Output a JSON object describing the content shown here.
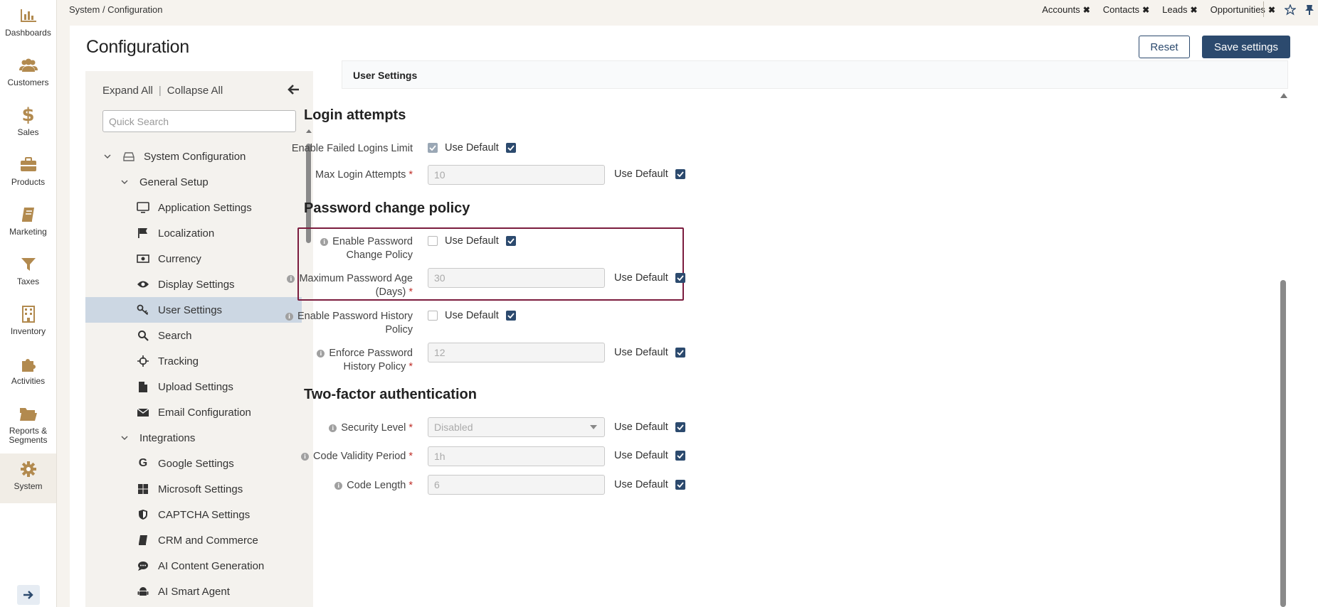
{
  "nav": {
    "items": [
      {
        "label": "Dashboards",
        "icon": "bar-chart-icon"
      },
      {
        "label": "Customers",
        "icon": "users-icon"
      },
      {
        "label": "Sales",
        "icon": "dollar-icon"
      },
      {
        "label": "Products",
        "icon": "briefcase-icon"
      },
      {
        "label": "Marketing",
        "icon": "book-icon"
      },
      {
        "label": "Taxes",
        "icon": "filter-icon"
      },
      {
        "label": "Inventory",
        "icon": "building-icon"
      },
      {
        "label": "Activities",
        "icon": "puzzle-icon"
      },
      {
        "label": "Reports &\nSegments",
        "icon": "folder-icon"
      },
      {
        "label": "System",
        "icon": "gear-icon"
      }
    ],
    "active": "System"
  },
  "topbar": {
    "breadcrumb": "System / Configuration",
    "tabs": [
      "Accounts",
      "Contacts",
      "Leads",
      "Opportunities"
    ]
  },
  "page": {
    "title": "Configuration",
    "reset_label": "Reset",
    "save_label": "Save settings"
  },
  "tree": {
    "expand_all": "Expand All",
    "collapse_all": "Collapse All",
    "search_placeholder": "Quick Search",
    "nodes": [
      {
        "label": "System Configuration",
        "level": 0,
        "icon": "drive-icon",
        "chevron": true
      },
      {
        "label": "General Setup",
        "level": 1,
        "chevron": true
      },
      {
        "label": "Application Settings",
        "level": 2,
        "icon": "monitor-icon"
      },
      {
        "label": "Localization",
        "level": 2,
        "icon": "flag-icon"
      },
      {
        "label": "Currency",
        "level": 2,
        "icon": "money-icon"
      },
      {
        "label": "Display Settings",
        "level": 2,
        "icon": "eye-icon"
      },
      {
        "label": "User Settings",
        "level": 2,
        "icon": "key-icon",
        "selected": true
      },
      {
        "label": "Search",
        "level": 2,
        "icon": "search-icon"
      },
      {
        "label": "Tracking",
        "level": 2,
        "icon": "crosshair-icon"
      },
      {
        "label": "Upload Settings",
        "level": 2,
        "icon": "file-icon"
      },
      {
        "label": "Email Configuration",
        "level": 2,
        "icon": "envelope-icon"
      },
      {
        "label": "Integrations",
        "level": 1,
        "chevron": true
      },
      {
        "label": "Google Settings",
        "level": 2,
        "icon": "google-icon"
      },
      {
        "label": "Microsoft Settings",
        "level": 2,
        "icon": "windows-icon"
      },
      {
        "label": "CAPTCHA Settings",
        "level": 2,
        "icon": "shield-icon"
      },
      {
        "label": "CRM and Commerce",
        "level": 2,
        "icon": "book-icon"
      },
      {
        "label": "AI Content Generation",
        "level": 2,
        "icon": "chat-icon"
      },
      {
        "label": "AI Smart Agent",
        "level": 2,
        "icon": "android-icon"
      }
    ]
  },
  "content": {
    "header": "User Settings",
    "use_default": "Use Default",
    "sections": {
      "login": "Login attempts",
      "password": "Password change policy",
      "twofa": "Two-factor authentication"
    },
    "fields": {
      "failed_logins": {
        "label": "Enable Failed Logins Limit"
      },
      "max_attempts": {
        "label": "Max Login Attempts",
        "value": "10"
      },
      "pwd_change": {
        "label": "Enable Password Change Policy"
      },
      "pwd_age": {
        "label": "Maximum Password Age (Days)",
        "value": "30"
      },
      "pwd_history": {
        "label": "Enable Password History Policy"
      },
      "enforce_history": {
        "label": "Enforce Password History Policy",
        "value": "12"
      },
      "security_level": {
        "label": "Security Level",
        "value": "Disabled"
      },
      "code_validity": {
        "label": "Code Validity Period",
        "value": "1h"
      },
      "code_length": {
        "label": "Code Length",
        "value": "6"
      }
    }
  }
}
